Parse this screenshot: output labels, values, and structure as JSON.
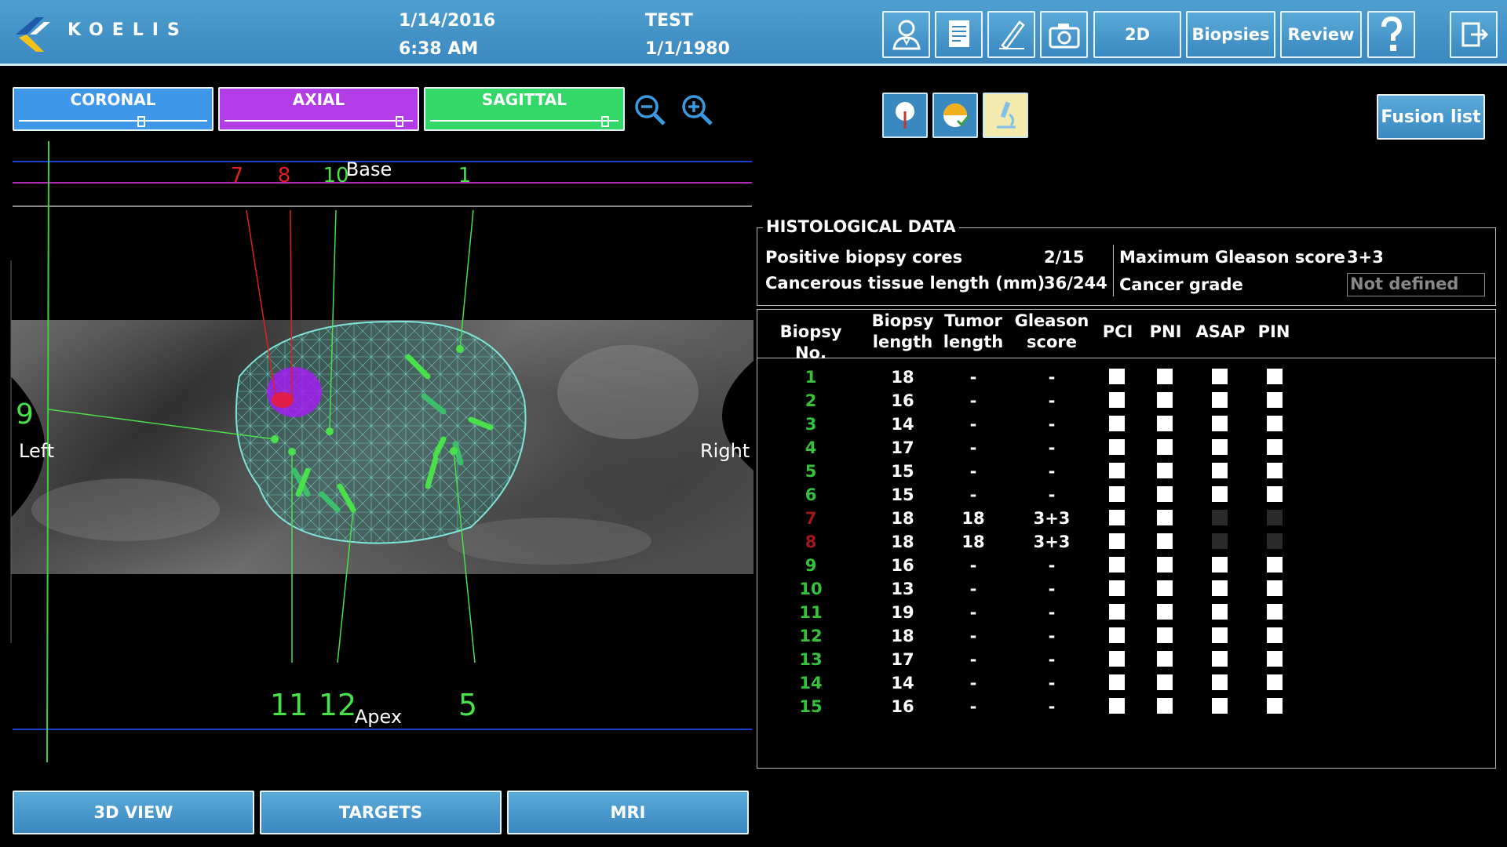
{
  "header": {
    "brand": "KOELIS",
    "date": "1/14/2016",
    "time": "6:38 AM",
    "patient_name": "TEST",
    "patient_dob": "1/1/1980",
    "buttons": {
      "patient_icon": "patient-icon",
      "report_icon": "report-icon",
      "annotate_icon": "pen-icon",
      "camera_icon": "camera-icon",
      "mode_2d": "2D",
      "biopsies": "Biopsies",
      "review": "Review",
      "help_icon": "help-icon",
      "exit_icon": "exit-icon"
    }
  },
  "views": {
    "coronal": {
      "label": "CORONAL",
      "color": "#3f97ea",
      "slider": 0.65
    },
    "axial": {
      "label": "AXIAL",
      "color": "#b23ce6",
      "slider": 0.93
    },
    "sagittal": {
      "label": "SAGITTAL",
      "color": "#34d868",
      "slider": 0.93
    }
  },
  "toolbar": {
    "fusion_list": "Fusion list"
  },
  "viewport": {
    "base_label": "Base",
    "apex_label": "Apex",
    "left_label": "Left",
    "right_label": "Right",
    "left_index": "9",
    "top_labels": [
      "7",
      "8",
      "10",
      "1"
    ],
    "bottom_labels": [
      "11",
      "12",
      "5"
    ]
  },
  "histology": {
    "title": "HISTOLOGICAL DATA",
    "positive_cores_label": "Positive biopsy cores",
    "positive_cores_value": "2/15",
    "tissue_length_label": "Cancerous tissue length (mm)",
    "tissue_length_value": "36/244",
    "max_gleason_label": "Maximum Gleason score",
    "max_gleason_value": "3+3",
    "cancer_grade_label": "Cancer grade",
    "cancer_grade_value": "Not defined"
  },
  "table": {
    "headers": {
      "biopsy_no": "Biopsy No.",
      "biopsy_length_1": "Biopsy",
      "biopsy_length_2": "length",
      "tumor_length_1": "Tumor",
      "tumor_length_2": "length",
      "gleason_1": "Gleason",
      "gleason_2": "score",
      "pci": "PCI",
      "pni": "PNI",
      "asap": "ASAP",
      "pin": "PIN"
    },
    "rows": [
      {
        "no": "1",
        "length": "18",
        "tumor": "-",
        "gleason": "-",
        "positive": false
      },
      {
        "no": "2",
        "length": "16",
        "tumor": "-",
        "gleason": "-",
        "positive": false
      },
      {
        "no": "3",
        "length": "14",
        "tumor": "-",
        "gleason": "-",
        "positive": false
      },
      {
        "no": "4",
        "length": "17",
        "tumor": "-",
        "gleason": "-",
        "positive": false
      },
      {
        "no": "5",
        "length": "15",
        "tumor": "-",
        "gleason": "-",
        "positive": false
      },
      {
        "no": "6",
        "length": "15",
        "tumor": "-",
        "gleason": "-",
        "positive": false
      },
      {
        "no": "7",
        "length": "18",
        "tumor": "18",
        "gleason": "3+3",
        "positive": true
      },
      {
        "no": "8",
        "length": "18",
        "tumor": "18",
        "gleason": "3+3",
        "positive": true
      },
      {
        "no": "9",
        "length": "16",
        "tumor": "-",
        "gleason": "-",
        "positive": false
      },
      {
        "no": "10",
        "length": "13",
        "tumor": "-",
        "gleason": "-",
        "positive": false
      },
      {
        "no": "11",
        "length": "19",
        "tumor": "-",
        "gleason": "-",
        "positive": false
      },
      {
        "no": "12",
        "length": "18",
        "tumor": "-",
        "gleason": "-",
        "positive": false
      },
      {
        "no": "13",
        "length": "17",
        "tumor": "-",
        "gleason": "-",
        "positive": false
      },
      {
        "no": "14",
        "length": "14",
        "tumor": "-",
        "gleason": "-",
        "positive": false
      },
      {
        "no": "15",
        "length": "16",
        "tumor": "-",
        "gleason": "-",
        "positive": false
      }
    ]
  },
  "bottom": {
    "view3d": "3D VIEW",
    "targets": "TARGETS",
    "mri": "MRI"
  },
  "colors": {
    "header": "#3a88c0",
    "negative": "#35c23a",
    "positive": "#a01818",
    "needle": "#4ae04a",
    "mesh": "#7fe3d8",
    "lesion": "#a020f0"
  }
}
